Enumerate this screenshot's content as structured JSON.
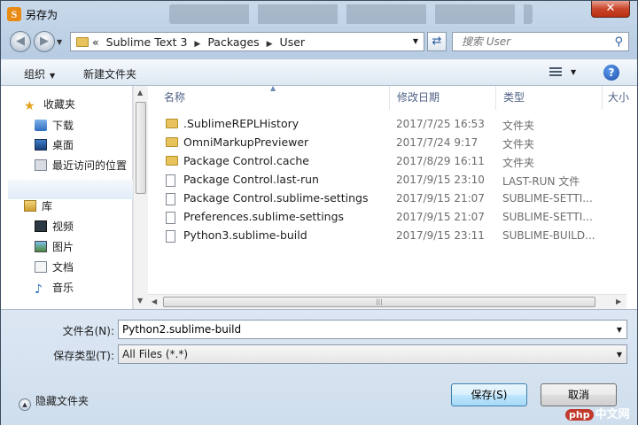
{
  "window": {
    "title": "另存为",
    "close_glyph": "✕"
  },
  "address": {
    "chevron": "«",
    "crumbs": [
      "Sublime Text 3",
      "Packages",
      "User"
    ],
    "sep": "▶"
  },
  "search": {
    "placeholder": "搜索 User"
  },
  "toolbar": {
    "organize": "组织",
    "new_folder": "新建文件夹",
    "help": "?"
  },
  "nav": {
    "favorites": "收藏夹",
    "fav_items": [
      "下载",
      "桌面",
      "最近访问的位置"
    ],
    "library": "库",
    "lib_items": [
      "视频",
      "图片",
      "文档",
      "音乐"
    ]
  },
  "columns": {
    "name": "名称",
    "modified": "修改日期",
    "type": "类型",
    "size": "大小"
  },
  "files": [
    {
      "name": ".SublimeREPLHistory",
      "date": "2017/7/25 16:53",
      "type": "文件夹",
      "kind": "folder"
    },
    {
      "name": "OmniMarkupPreviewer",
      "date": "2017/7/24 9:17",
      "type": "文件夹",
      "kind": "folder"
    },
    {
      "name": "Package Control.cache",
      "date": "2017/8/29 16:11",
      "type": "文件夹",
      "kind": "folder"
    },
    {
      "name": "Package Control.last-run",
      "date": "2017/9/15 23:10",
      "type": "LAST-RUN 文件",
      "kind": "file"
    },
    {
      "name": "Package Control.sublime-settings",
      "date": "2017/9/15 21:07",
      "type": "SUBLIME-SETTI...",
      "kind": "file"
    },
    {
      "name": "Preferences.sublime-settings",
      "date": "2017/9/15 21:07",
      "type": "SUBLIME-SETTI...",
      "kind": "file"
    },
    {
      "name": "Python3.sublime-build",
      "date": "2017/9/15 23:11",
      "type": "SUBLIME-BUILD...",
      "kind": "file"
    }
  ],
  "form": {
    "filename_label": "文件名(N):",
    "filename_value": "Python2.sublime-build",
    "type_label": "保存类型(T):",
    "type_value": "All Files (*.*)",
    "save": "保存(S)",
    "cancel": "取消",
    "hide_folders": "隐藏文件夹"
  },
  "watermark": {
    "badge": "php",
    "text": "中文网"
  }
}
